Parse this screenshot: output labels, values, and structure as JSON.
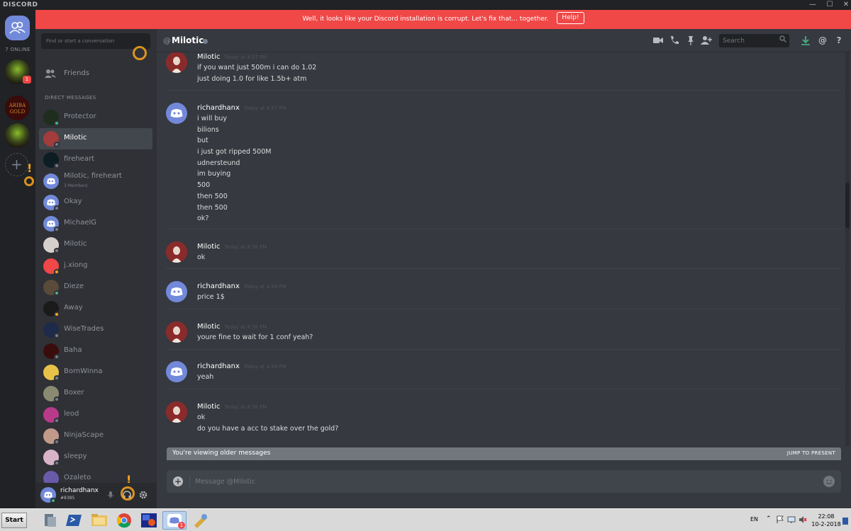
{
  "window": {
    "brand": "DISCORD",
    "minimize": "—",
    "maximize": "☐",
    "close": "✕"
  },
  "banner": {
    "text": "Well, it looks like your Discord installation is corrupt. Let's fix that... together.",
    "button": "Help!"
  },
  "guilds": {
    "online_label": "7 ONLINE",
    "badge": "1",
    "add": "+"
  },
  "sidebar": {
    "search_placeholder": "Find or start a conversation",
    "friends_label": "Friends",
    "dm_header": "DIRECT MESSAGES",
    "dms": [
      {
        "name": "Protector",
        "status": "online",
        "avatar": "#1f2d1e"
      },
      {
        "name": "Milotic",
        "status": "offline",
        "avatar": "#a33c3c",
        "active": true
      },
      {
        "name": "fireheart",
        "status": "offline",
        "avatar": "#0c1d24"
      },
      {
        "name": "Milotic, fireheart",
        "sub": "3 Members",
        "status": "",
        "avatar": "#7289da"
      },
      {
        "name": "Okay",
        "status": "offline",
        "avatar": "#7289da"
      },
      {
        "name": "MichaelG",
        "status": "offline",
        "avatar": "#7289da"
      },
      {
        "name": "Milotic",
        "status": "offline",
        "avatar": "#d6d0cc"
      },
      {
        "name": "j.xiong",
        "status": "idle",
        "avatar": "#f04747"
      },
      {
        "name": "Dieze",
        "status": "online",
        "avatar": "#5a4a3a"
      },
      {
        "name": "Away",
        "status": "idle",
        "avatar": "#1a1a1a"
      },
      {
        "name": "WiseTrades",
        "status": "offline",
        "avatar": "#1e2a4a"
      },
      {
        "name": "Baha",
        "status": "offline",
        "avatar": "#3a0d0d"
      },
      {
        "name": "BornWinna",
        "status": "offline",
        "avatar": "#e8c248"
      },
      {
        "name": "Boxer",
        "status": "offline",
        "avatar": "#8a8a72"
      },
      {
        "name": "leod",
        "status": "offline",
        "avatar": "#b83a8a"
      },
      {
        "name": "NinjaScape",
        "status": "offline",
        "avatar": "#c29a8a"
      },
      {
        "name": "sleepy",
        "status": "offline",
        "avatar": "#d8b4c8"
      },
      {
        "name": "Ozaleto",
        "status": "",
        "avatar": "#6a5aaa"
      }
    ]
  },
  "user": {
    "name": "richardhanx",
    "tag": "#8385"
  },
  "chat": {
    "at": "@",
    "title": "Milotic",
    "search_placeholder": "Search",
    "icons": [
      "video",
      "phone",
      "pin",
      "add-friend",
      "download",
      "mention",
      "help"
    ]
  },
  "messages": [
    {
      "author": "Milotic",
      "time": "Today at 4:57 PM",
      "avatar": "#a33c3c",
      "lines": [
        "if you want just 500m i can do 1.02",
        "just doing 1.0 for like 1.5b+ atm"
      ]
    },
    {
      "author": "richardhanx",
      "time": "Today at 4:57 PM",
      "avatar": "#7289da",
      "lines": [
        "i will buy",
        "bilions",
        "but",
        "i just got ripped 500M",
        "udnersteund",
        "im buying",
        "500",
        "then 500",
        "then 500",
        "ok?"
      ]
    },
    {
      "author": "Milotic",
      "time": "Today at 4:58 PM",
      "avatar": "#a33c3c",
      "lines": [
        "ok"
      ]
    },
    {
      "author": "richardhanx",
      "time": "Today at 4:58 PM",
      "avatar": "#7289da",
      "lines": [
        "price 1$"
      ]
    },
    {
      "author": "Milotic",
      "time": "Today at 4:58 PM",
      "avatar": "#a33c3c",
      "lines": [
        "youre fine to wait for 1 conf yeah?"
      ]
    },
    {
      "author": "richardhanx",
      "time": "Today at 4:58 PM",
      "avatar": "#7289da",
      "lines": [
        "yeah"
      ]
    },
    {
      "author": "Milotic",
      "time": "Today at 4:58 PM",
      "avatar": "#a33c3c",
      "lines": [
        "ok",
        "do you have a acc to stake over the gold?"
      ]
    }
  ],
  "older_bar": {
    "text": "You're viewing older messages",
    "jump": "JUMP TO PRESENT"
  },
  "composer": {
    "placeholder": "Message @Milotic",
    "plus": "+"
  },
  "taskbar": {
    "start": "Start",
    "lang": "EN",
    "tray": "⌃",
    "time": "22:08",
    "date": "10-2-2018",
    "apps": [
      "server-manager",
      "powershell",
      "file-explorer",
      "chrome",
      "paint-app",
      "discord",
      "tools"
    ],
    "discord_badge": "1"
  },
  "colors": {
    "accent": "#7289da",
    "banner": "#f04747",
    "online": "#43b581",
    "idle": "#faa61a"
  }
}
